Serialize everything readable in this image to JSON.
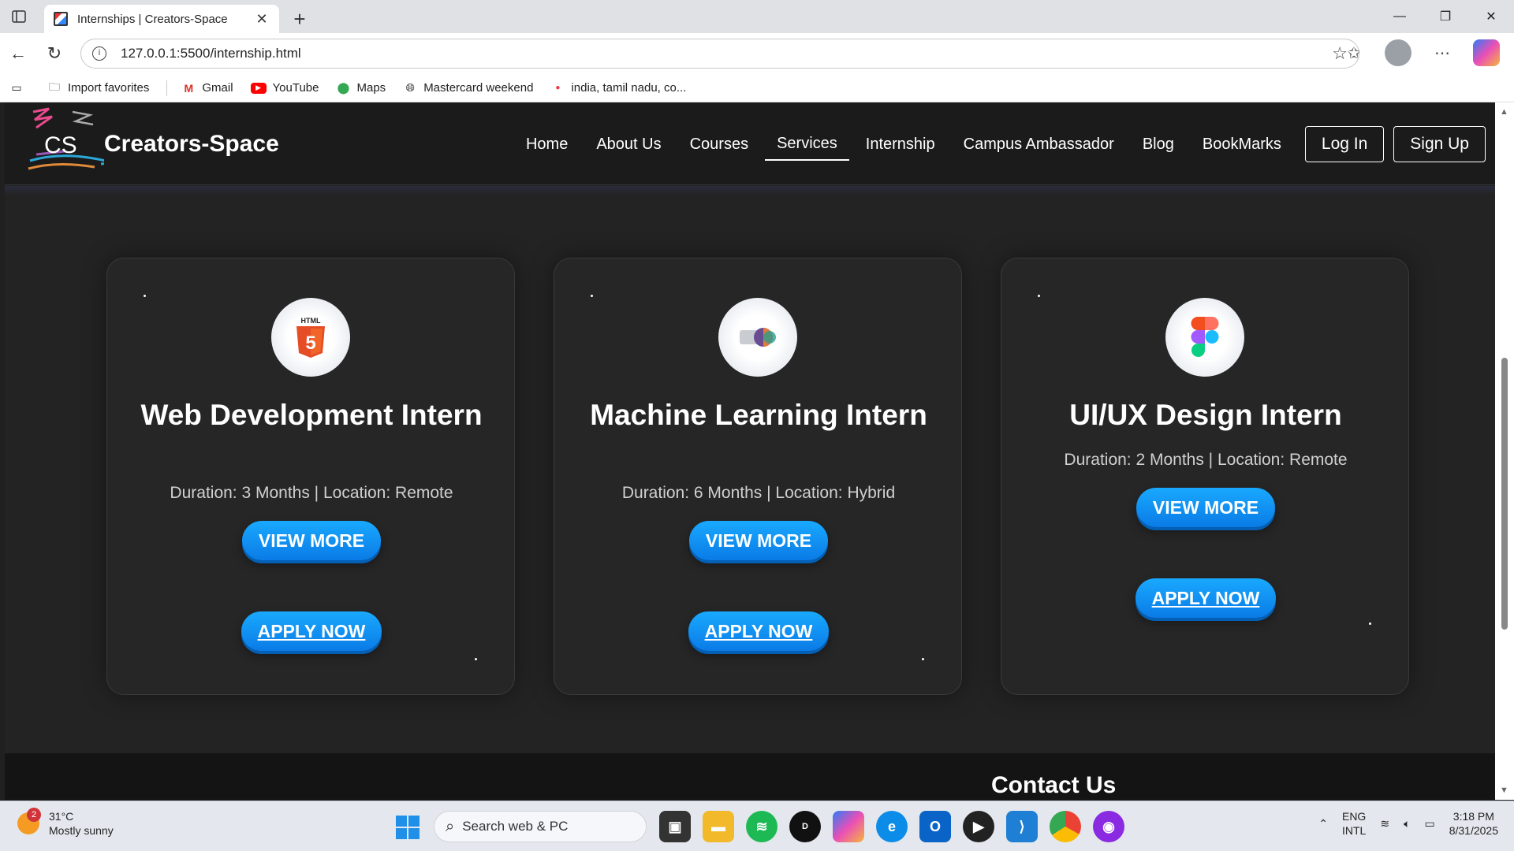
{
  "browser": {
    "tab_title": "Internships | Creators-Space",
    "url": "127.0.0.1:5500/internship.html",
    "favorites": [
      {
        "label": "Import favorites",
        "icon": "folder-import-icon"
      },
      {
        "label": "Gmail",
        "icon": "gmail-icon"
      },
      {
        "label": "YouTube",
        "icon": "youtube-icon"
      },
      {
        "label": "Maps",
        "icon": "maps-pin-icon"
      },
      {
        "label": "Mastercard weekend",
        "icon": "globe-icon"
      },
      {
        "label": "india, tamil nadu, co...",
        "icon": "flame-icon"
      }
    ]
  },
  "site": {
    "logo_text": "CS",
    "brand": "Creators-Space",
    "nav": [
      "Home",
      "About Us",
      "Courses",
      "Services",
      "Internship",
      "Campus Ambassador",
      "Blog",
      "BookMarks"
    ],
    "active_nav": "Services",
    "login": "Log In",
    "signup": "Sign Up"
  },
  "cards": [
    {
      "title": "Web Development Intern",
      "meta": "Duration: 3 Months | Location: Remote",
      "view": "VIEW MORE",
      "apply": "APPLY NOW",
      "icon": "html5-icon",
      "icon_text": "HTML"
    },
    {
      "title": "Machine Learning Intern",
      "meta": "Duration: 6 Months | Location: Hybrid",
      "view": "VIEW MORE",
      "apply": "APPLY NOW",
      "icon": "machine-learning-icon"
    },
    {
      "title": "UI/UX Design Intern",
      "meta": "Duration: 2 Months | Location: Remote",
      "view": "VIEW MORE",
      "apply": "APPLY NOW",
      "icon": "figma-icon"
    }
  ],
  "footer": {
    "contact_heading": "Contact Us"
  },
  "taskbar": {
    "weather_badge": "2",
    "temp": "31°C",
    "condition": "Mostly sunny",
    "search_placeholder": "Search web & PC",
    "lang1": "ENG",
    "lang2": "INTL",
    "time": "3:18 PM",
    "date": "8/31/2025"
  }
}
